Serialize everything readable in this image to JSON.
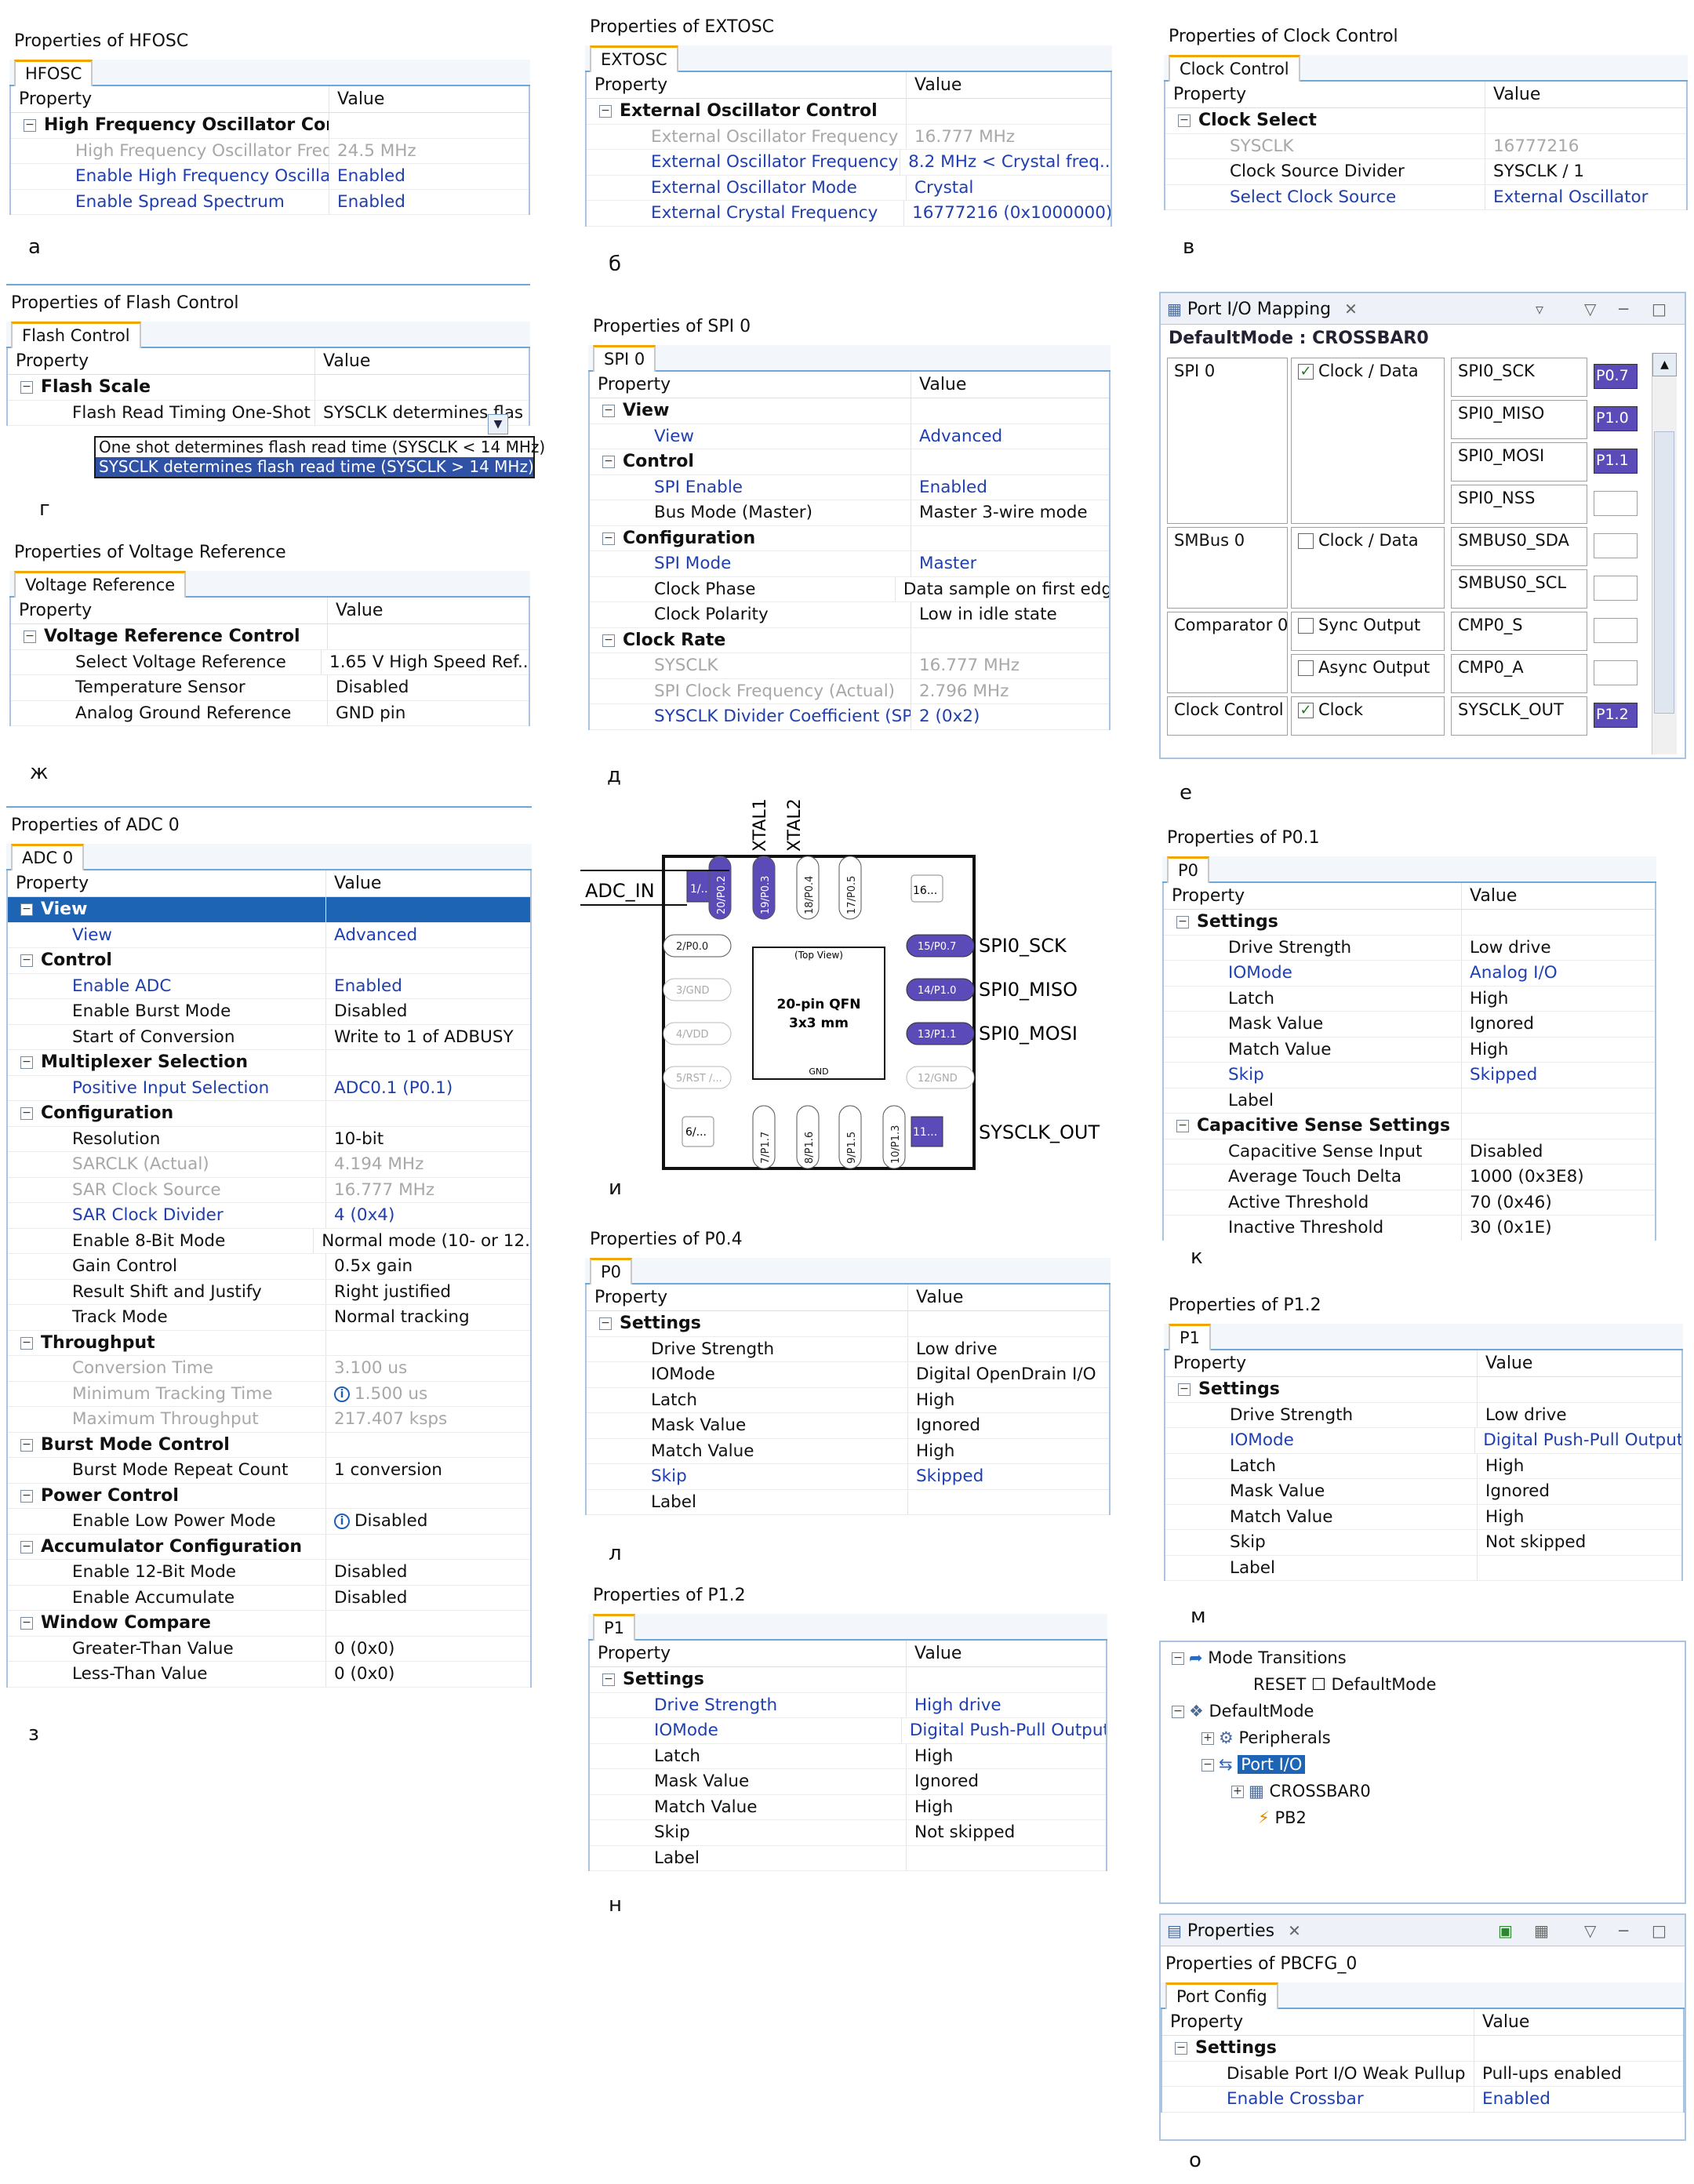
{
  "letters": {
    "a": "а",
    "b": "б",
    "v": "в",
    "g": "г",
    "zh": "ж",
    "d": "д",
    "e": "е",
    "z": "з",
    "i": "и",
    "k": "к",
    "l": "л",
    "m": "м",
    "n": "н",
    "o": "о"
  },
  "hfosc": {
    "title": "Properties of HFOSC",
    "tab": "HFOSC",
    "col1": "Property",
    "col2": "Value",
    "rows": [
      {
        "p": "High Frequency Oscillator Contı",
        "v": "",
        "t": "grp"
      },
      {
        "p": "High Frequency Oscillator Freque",
        "v": "24.5 MHz",
        "t": "dis"
      },
      {
        "p": "Enable High Frequency Oscillator",
        "v": "Enabled",
        "t": "link"
      },
      {
        "p": "Enable Spread Spectrum",
        "v": "Enabled",
        "t": "link"
      }
    ]
  },
  "extosc": {
    "title": "Properties of EXTOSC",
    "tab": "EXTOSC",
    "col1": "Property",
    "col2": "Value",
    "rows": [
      {
        "p": "External Oscillator Control",
        "v": "",
        "t": "grp"
      },
      {
        "p": "External Oscillator Frequency",
        "v": "16.777 MHz",
        "t": "dis"
      },
      {
        "p": "External Oscillator Frequency Cc",
        "v": "8.2 MHz < Crystal freq...",
        "t": "link"
      },
      {
        "p": "External Oscillator Mode",
        "v": "Crystal",
        "t": "link"
      },
      {
        "p": "External Crystal Frequency",
        "v": "16777216 (0x1000000)",
        "t": "link"
      }
    ]
  },
  "clock": {
    "title": "Properties of Clock Control",
    "tab": "Clock Control",
    "col1": "Property",
    "col2": "Value",
    "rows": [
      {
        "p": "Clock Select",
        "v": "",
        "t": "grp"
      },
      {
        "p": "SYSCLK",
        "v": "16777216",
        "t": "dis"
      },
      {
        "p": "Clock Source Divider",
        "v": "SYSCLK / 1",
        "t": "norm"
      },
      {
        "p": "Select Clock Source",
        "v": "External Oscillator",
        "t": "link"
      }
    ]
  },
  "flash": {
    "title": "Properties of Flash Control",
    "tab": "Flash Control",
    "col1": "Property",
    "col2": "Value",
    "rows": [
      {
        "p": "Flash Scale",
        "v": "",
        "t": "grp"
      },
      {
        "p": "Flash Read Timing One-Shot Byp",
        "v": "SYSCLK determines flas",
        "t": "norm"
      }
    ],
    "options": [
      "One shot determines flash read time (SYSCLK < 14 MHz)",
      "SYSCLK determines flash read time (SYSCLK > 14 MHz)"
    ]
  },
  "vref": {
    "title": "Properties of Voltage Reference",
    "tab": "Voltage Reference",
    "col1": "Property",
    "col2": "Value",
    "rows": [
      {
        "p": "Voltage Reference Control",
        "v": "",
        "t": "grp"
      },
      {
        "p": "Select Voltage Reference",
        "v": "1.65 V High Speed Ref...",
        "t": "norm"
      },
      {
        "p": "Temperature Sensor",
        "v": "Disabled",
        "t": "norm"
      },
      {
        "p": "Analog Ground Reference",
        "v": "GND pin",
        "t": "norm"
      }
    ]
  },
  "spi": {
    "title": "Properties of SPI 0",
    "tab": "SPI 0",
    "col1": "Property",
    "col2": "Value",
    "rows": [
      {
        "p": "View",
        "v": "",
        "t": "grp"
      },
      {
        "p": "View",
        "v": "Advanced",
        "t": "link"
      },
      {
        "p": "Control",
        "v": "",
        "t": "grp"
      },
      {
        "p": "SPI Enable",
        "v": "Enabled",
        "t": "link"
      },
      {
        "p": "Bus Mode (Master)",
        "v": "Master 3-wire mode",
        "t": "norm"
      },
      {
        "p": "Configuration",
        "v": "",
        "t": "grp"
      },
      {
        "p": "SPI Mode",
        "v": "Master",
        "t": "link"
      },
      {
        "p": "Clock Phase",
        "v": "Data sample on first edge",
        "t": "norm"
      },
      {
        "p": "Clock Polarity",
        "v": "Low in idle state",
        "t": "norm"
      },
      {
        "p": "Clock Rate",
        "v": "",
        "t": "grp"
      },
      {
        "p": "SYSCLK",
        "v": "16.777 MHz",
        "t": "dis"
      },
      {
        "p": "SPI Clock Frequency (Actual)",
        "v": "2.796 MHz",
        "t": "dis"
      },
      {
        "p": "SYSCLK Divider Coefficient (SPI0",
        "v": "2 (0x2)",
        "t": "link"
      }
    ]
  },
  "adc": {
    "title": "Properties of ADC 0",
    "tab": "ADC 0",
    "col1": "Property",
    "col2": "Value",
    "rows": [
      {
        "p": "View",
        "v": "",
        "t": "sel"
      },
      {
        "p": "View",
        "v": "Advanced",
        "t": "link"
      },
      {
        "p": "Control",
        "v": "",
        "t": "grp"
      },
      {
        "p": "Enable ADC",
        "v": "Enabled",
        "t": "link"
      },
      {
        "p": "Enable Burst Mode",
        "v": "Disabled",
        "t": "norm"
      },
      {
        "p": "Start of Conversion",
        "v": "Write to 1 of ADBUSY",
        "t": "norm"
      },
      {
        "p": "Multiplexer Selection",
        "v": "",
        "t": "grp"
      },
      {
        "p": "Positive Input Selection",
        "v": "ADC0.1 (P0.1)",
        "t": "link"
      },
      {
        "p": "Configuration",
        "v": "",
        "t": "grp"
      },
      {
        "p": "Resolution",
        "v": "10-bit",
        "t": "norm"
      },
      {
        "p": "SARCLK (Actual)",
        "v": "4.194 MHz",
        "t": "dis"
      },
      {
        "p": "SAR Clock Source",
        "v": "16.777 MHz",
        "t": "dis"
      },
      {
        "p": "SAR Clock Divider",
        "v": "4 (0x4)",
        "t": "link"
      },
      {
        "p": "Enable 8-Bit Mode",
        "v": "Normal mode (10- or 12...",
        "t": "norm"
      },
      {
        "p": "Gain Control",
        "v": "0.5x gain",
        "t": "norm"
      },
      {
        "p": "Result Shift and Justify",
        "v": "Right justified",
        "t": "norm"
      },
      {
        "p": "Track Mode",
        "v": "Normal tracking",
        "t": "norm"
      },
      {
        "p": "Throughput",
        "v": "",
        "t": "grp"
      },
      {
        "p": "Conversion Time",
        "v": "3.100 us",
        "t": "dis"
      },
      {
        "p": "Minimum Tracking Time",
        "v": "1.500 us",
        "t": "disinfo"
      },
      {
        "p": "Maximum Throughput",
        "v": "217.407 ksps",
        "t": "dis"
      },
      {
        "p": "Burst Mode Control",
        "v": "",
        "t": "grp"
      },
      {
        "p": "Burst Mode Repeat Count",
        "v": "1 conversion",
        "t": "norm"
      },
      {
        "p": "Power Control",
        "v": "",
        "t": "grp"
      },
      {
        "p": "Enable Low Power Mode",
        "v": "Disabled",
        "t": "info"
      },
      {
        "p": "Accumulator Configuration",
        "v": "",
        "t": "grp"
      },
      {
        "p": "Enable 12-Bit Mode",
        "v": "Disabled",
        "t": "norm"
      },
      {
        "p": "Enable Accumulate",
        "v": "Disabled",
        "t": "norm"
      },
      {
        "p": "Window Compare",
        "v": "",
        "t": "grp"
      },
      {
        "p": "Greater-Than Value",
        "v": "0 (0x0)",
        "t": "norm"
      },
      {
        "p": "Less-Than Value",
        "v": "0 (0x0)",
        "t": "norm"
      }
    ]
  },
  "p01": {
    "title": "Properties of P0.1",
    "tab": "P0",
    "col1": "Property",
    "col2": "Value",
    "rows": [
      {
        "p": "Settings",
        "v": "",
        "t": "grp"
      },
      {
        "p": "Drive Strength",
        "v": "Low drive",
        "t": "norm"
      },
      {
        "p": "IOMode",
        "v": "Analog I/O",
        "t": "link"
      },
      {
        "p": "Latch",
        "v": "High",
        "t": "norm"
      },
      {
        "p": "Mask Value",
        "v": "Ignored",
        "t": "norm"
      },
      {
        "p": "Match Value",
        "v": "High",
        "t": "norm"
      },
      {
        "p": "Skip",
        "v": "Skipped",
        "t": "link"
      },
      {
        "p": "Label",
        "v": "",
        "t": "norm"
      },
      {
        "p": "Capacitive Sense Settings",
        "v": "",
        "t": "grp"
      },
      {
        "p": "Capacitive Sense Input",
        "v": "Disabled",
        "t": "norm"
      },
      {
        "p": "Average Touch Delta",
        "v": "1000 (0x3E8)",
        "t": "norm"
      },
      {
        "p": "Active Threshold",
        "v": "70 (0x46)",
        "t": "norm"
      },
      {
        "p": "Inactive Threshold",
        "v": "30 (0x1E)",
        "t": "norm"
      }
    ]
  },
  "p04": {
    "title": "Properties of P0.4",
    "tab": "P0",
    "col1": "Property",
    "col2": "Value",
    "rows": [
      {
        "p": "Settings",
        "v": "",
        "t": "grp"
      },
      {
        "p": "Drive Strength",
        "v": "Low drive",
        "t": "norm"
      },
      {
        "p": "IOMode",
        "v": "Digital OpenDrain I/O",
        "t": "norm"
      },
      {
        "p": "Latch",
        "v": "High",
        "t": "norm"
      },
      {
        "p": "Mask Value",
        "v": "Ignored",
        "t": "norm"
      },
      {
        "p": "Match Value",
        "v": "High",
        "t": "norm"
      },
      {
        "p": "Skip",
        "v": "Skipped",
        "t": "link"
      },
      {
        "p": "Label",
        "v": "",
        "t": "norm"
      }
    ]
  },
  "p12a": {
    "title": "Properties of P1.2",
    "tab": "P1",
    "col1": "Property",
    "col2": "Value",
    "rows": [
      {
        "p": "Settings",
        "v": "",
        "t": "grp"
      },
      {
        "p": "Drive Strength",
        "v": "Low drive",
        "t": "norm"
      },
      {
        "p": "IOMode",
        "v": "Digital Push-Pull Output",
        "t": "link"
      },
      {
        "p": "Latch",
        "v": "High",
        "t": "norm"
      },
      {
        "p": "Mask Value",
        "v": "Ignored",
        "t": "norm"
      },
      {
        "p": "Match Value",
        "v": "High",
        "t": "norm"
      },
      {
        "p": "Skip",
        "v": "Not skipped",
        "t": "norm"
      },
      {
        "p": "Label",
        "v": "",
        "t": "norm"
      }
    ]
  },
  "p12b": {
    "title": "Properties of P1.2",
    "tab": "P1",
    "col1": "Property",
    "col2": "Value",
    "rows": [
      {
        "p": "Settings",
        "v": "",
        "t": "grp"
      },
      {
        "p": "Drive Strength",
        "v": "High drive",
        "t": "link"
      },
      {
        "p": "IOMode",
        "v": "Digital Push-Pull Output",
        "t": "link"
      },
      {
        "p": "Latch",
        "v": "High",
        "t": "norm"
      },
      {
        "p": "Mask Value",
        "v": "Ignored",
        "t": "norm"
      },
      {
        "p": "Match Value",
        "v": "High",
        "t": "norm"
      },
      {
        "p": "Skip",
        "v": "Not skipped",
        "t": "norm"
      },
      {
        "p": "Label",
        "v": "",
        "t": "norm"
      }
    ]
  },
  "pbcfg": {
    "view_title": "Properties",
    "title": "Properties of PBCFG_0",
    "tab": "Port Config",
    "col1": "Property",
    "col2": "Value",
    "rows": [
      {
        "p": "Settings",
        "v": "",
        "t": "grp"
      },
      {
        "p": "Disable Port I/O Weak Pullup",
        "v": "Pull-ups enabled",
        "t": "norm"
      },
      {
        "p": "Enable Crossbar",
        "v": "Enabled",
        "t": "link"
      }
    ]
  },
  "portmap": {
    "view_title": "Port I/O Mapping",
    "mode": "DefaultMode : CROSSBAR0",
    "groups": [
      {
        "name": "SPI 0",
        "check": "Clock / Data",
        "checked": true
      },
      {
        "name": "SMBus 0",
        "check": "Clock / Data",
        "checked": false
      },
      {
        "name": "Comparator 0",
        "check": "Sync Output",
        "checked": false
      },
      {
        "name": "",
        "check": "Async Output",
        "checked": false
      },
      {
        "name": "Clock Control",
        "check": "Clock",
        "checked": true
      }
    ],
    "signals": [
      "SPI0_SCK",
      "SPI0_MISO",
      "SPI0_MOSI",
      "SPI0_NSS",
      "SMBUS0_SDA",
      "SMBUS0_SCL",
      "CMP0_S",
      "CMP0_A",
      "SYSCLK_OUT"
    ],
    "pins": [
      "P0.7",
      "P1.0",
      "P1.1",
      "",
      "",
      "",
      "",
      "",
      "P1.2"
    ]
  },
  "tree": {
    "items": [
      "Mode Transitions",
      "RESET ☐ DefaultMode",
      "DefaultMode",
      "Peripherals",
      "Port I/O",
      "CROSSBAR0",
      "PB2"
    ]
  },
  "chip": {
    "center": "20-pin QFN",
    "center2": "3x3 mm",
    "topview": "(Top View)",
    "gnd": "GND",
    "top_pins": [
      "1/...",
      "20/P0.2",
      "19/P0.3",
      "18/P0.4",
      "17/P0.5",
      "16..."
    ],
    "left_pins": [
      "2/P0.0",
      "3/GND",
      "4/VDD",
      "5/RST /...",
      "6/..."
    ],
    "right_pins": [
      "15/P0.7",
      "14/P1.0",
      "13/P1.1",
      "12/GND",
      "11..."
    ],
    "bottom_pins": [
      "7/P1.7",
      "8/P1.6",
      "9/P1.5",
      "10/P1.3"
    ],
    "labels": {
      "xtal1": "XTAL1",
      "xtal2": "XTAL2",
      "adc_in": "ADC_IN",
      "sck": "SPI0_SCK",
      "miso": "SPI0_MISO",
      "mosi": "SPI0_MOSI",
      "sysclk": "SYSCLK_OUT"
    }
  },
  "colors": {
    "tab_accent": "#f0a500",
    "link": "#1f3fae",
    "selected": "#1e64b4",
    "pin_fill": "#5b4bb8"
  }
}
